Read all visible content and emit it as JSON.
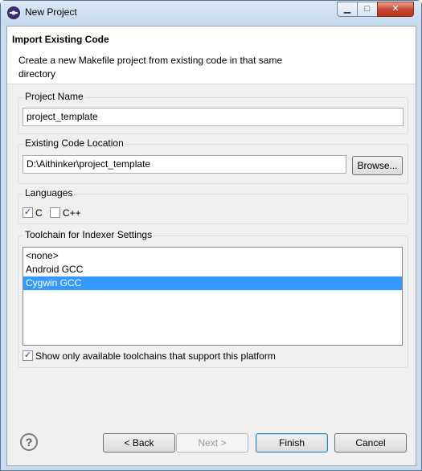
{
  "window": {
    "title": "New Project",
    "minimize_glyph": "▁",
    "maximize_glyph": "□",
    "close_glyph": "✕"
  },
  "banner": {
    "title": "Import Existing Code",
    "description": "Create a new Makefile project from existing code in that same directory"
  },
  "project_name": {
    "label": "Project Name",
    "value": "project_template"
  },
  "code_location": {
    "label": "Existing Code Location",
    "value": "D:\\Aithinker\\project_template",
    "browse_label": "Browse..."
  },
  "languages": {
    "label": "Languages",
    "options": [
      {
        "label": "C",
        "checked": true
      },
      {
        "label": "C++",
        "checked": false
      }
    ]
  },
  "toolchain": {
    "label": "Toolchain for Indexer Settings",
    "items": [
      "<none>",
      "Android GCC",
      "Cygwin GCC"
    ],
    "selected": "Cygwin GCC",
    "show_only_label": "Show only available toolchains that support this platform",
    "show_only_checked": true
  },
  "footer": {
    "help_glyph": "?",
    "back_label": "< Back",
    "next_label": "Next >",
    "finish_label": "Finish",
    "cancel_label": "Cancel"
  },
  "icons": {
    "app": "eclipse-icon",
    "help": "help-icon"
  }
}
